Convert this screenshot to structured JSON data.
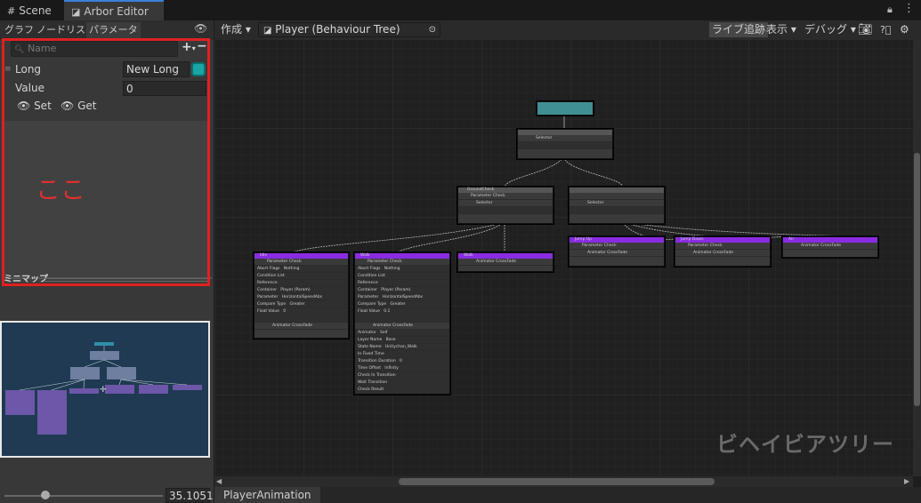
{
  "tabs": [
    {
      "label": "Scene",
      "icon": "grid-icon"
    },
    {
      "label": "Arbor Editor",
      "icon": "arbor-icon"
    }
  ],
  "left_tabs": [
    "グラフ",
    "ノードリスト",
    "パラメータ"
  ],
  "search": {
    "placeholder": "Name"
  },
  "parameters": [
    {
      "name": "Long",
      "value": "New Long"
    },
    {
      "name": "Value",
      "value": "0"
    }
  ],
  "set_label": "Set",
  "get_label": "Get",
  "annotation": "ここ",
  "minimap_label": "ミニマップ",
  "zoom_value": "35.1051",
  "toolbar": {
    "create": "作成",
    "graph_name": "Player (Behaviour Tree)",
    "live_tracking": "ライブ追跡",
    "view": "表示",
    "debug": "デバッグ"
  },
  "footer_tab": "PlayerAnimation",
  "watermark": "ビヘイビアツリー",
  "nodes": {
    "root": "",
    "selector1": "Selector",
    "groundcheck_title": "GroundCheck",
    "param_check": "Parameter Check",
    "selector": "Selector",
    "idle_title": "Idle",
    "walk_title": "Walk",
    "run_title": "Walk",
    "jumpup_title": "Jump Up",
    "jumpdown_title": "Jump Down",
    "air_title": "Air",
    "crossfade": "Animator CrossFade",
    "abort_flags": "Abort Flags",
    "nothing": "Nothing",
    "condition_list": "Condition List",
    "reference": "Reference",
    "container": "Container",
    "parameter": "Parameter",
    "compare_type": "Compare Type",
    "float_value": "Float Value",
    "container_val": "Player (Param)",
    "param_val": "HorizontalSpeedAbs",
    "compare_val": "Greater",
    "float_val_idle": "0",
    "float_val_walk": "0.1",
    "animator": "Animator",
    "layer_name": "Layer Name",
    "state_name": "State Name",
    "in_fixed_time": "In Fixed Time",
    "transition_duration": "Transition Duration",
    "time_offset": "Time Offset",
    "check_in_transition": "Check In Transition",
    "wait_transition": "Wait Transition",
    "check_result": "Check Result",
    "animator_val": "Self",
    "layer_val": "Base",
    "state_val": "Unitychan_Walk",
    "duration_val": "0",
    "offset_val": "Infinity"
  }
}
